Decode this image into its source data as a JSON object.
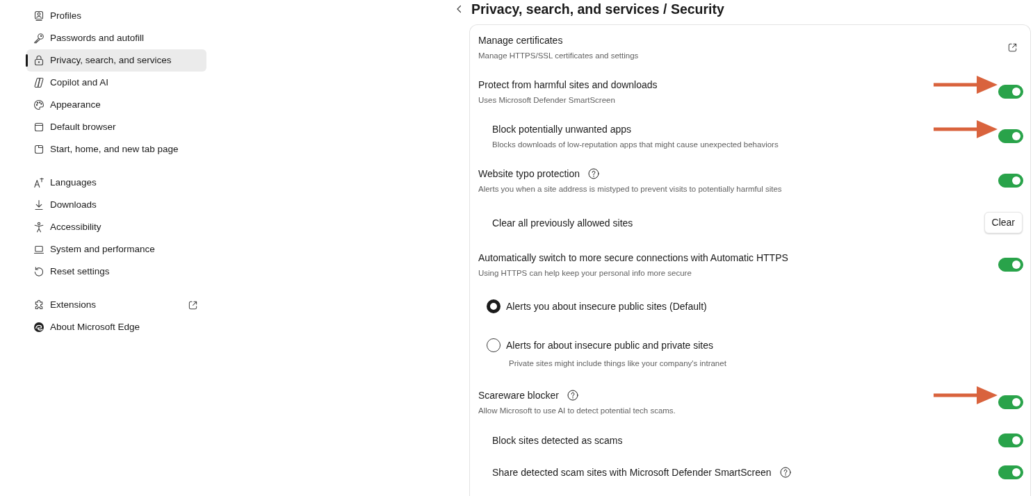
{
  "sidebar": {
    "groups": [
      {
        "items": [
          {
            "label": "Profiles",
            "selected": false,
            "external": false
          },
          {
            "label": "Passwords and autofill",
            "selected": false,
            "external": false
          },
          {
            "label": "Privacy, search, and services",
            "selected": true,
            "external": false
          },
          {
            "label": "Copilot and AI",
            "selected": false,
            "external": false
          },
          {
            "label": "Appearance",
            "selected": false,
            "external": false
          },
          {
            "label": "Default browser",
            "selected": false,
            "external": false
          },
          {
            "label": "Start, home, and new tab page",
            "selected": false,
            "external": false
          }
        ]
      },
      {
        "items": [
          {
            "label": "Languages",
            "selected": false,
            "external": false
          },
          {
            "label": "Downloads",
            "selected": false,
            "external": false
          },
          {
            "label": "Accessibility",
            "selected": false,
            "external": false
          },
          {
            "label": "System and performance",
            "selected": false,
            "external": false
          },
          {
            "label": "Reset settings",
            "selected": false,
            "external": false
          }
        ]
      },
      {
        "items": [
          {
            "label": "Extensions",
            "selected": false,
            "external": true
          },
          {
            "label": "About Microsoft Edge",
            "selected": false,
            "external": false
          }
        ]
      }
    ]
  },
  "header": {
    "title": "Privacy, search, and services / Security"
  },
  "settings": [
    {
      "kind": "link",
      "title": "Manage certificates",
      "description": "Manage HTTPS/SSL certificates and settings",
      "help": false,
      "highlighted": false
    },
    {
      "kind": "toggle",
      "title": "Protect from harmful sites and downloads",
      "description": "Uses Microsoft Defender SmartScreen",
      "help": false,
      "on": true,
      "highlighted": true,
      "children": [
        {
          "kind": "toggle",
          "title": "Block potentially unwanted apps",
          "description": "Blocks downloads of low-reputation apps that might cause unexpected behaviors",
          "help": false,
          "on": true,
          "highlighted": true
        }
      ]
    },
    {
      "kind": "toggle",
      "title": "Website typo protection",
      "description": "Alerts you when a site address is mistyped to prevent visits to potentially harmful sites",
      "help": true,
      "on": true,
      "highlighted": false,
      "children": [
        {
          "kind": "button",
          "title": "Clear all previously allowed sites",
          "button": "Clear",
          "help": false,
          "highlighted": false
        }
      ]
    },
    {
      "kind": "toggle",
      "title": "Automatically switch to more secure connections with Automatic HTTPS",
      "description": "Using HTTPS can help keep your personal info more secure",
      "help": false,
      "on": true,
      "highlighted": false,
      "children": [
        {
          "kind": "radio",
          "title": "Alerts you about insecure public sites (Default)",
          "help": false,
          "selected": true,
          "highlighted": false
        },
        {
          "kind": "radio",
          "title": "Alerts for about insecure public and private sites",
          "description": "Private sites might include things like your company's intranet",
          "help": false,
          "selected": false,
          "highlighted": false
        }
      ]
    },
    {
      "kind": "toggle",
      "title": "Scareware blocker",
      "description": "Allow Microsoft to use AI to detect potential tech scams.",
      "help": true,
      "on": true,
      "highlighted": true,
      "children": [
        {
          "kind": "toggle",
          "title": "Block sites detected as scams",
          "help": false,
          "on": true,
          "highlighted": false
        },
        {
          "kind": "toggle",
          "title": "Share detected scam sites with Microsoft Defender SmartScreen",
          "help": true,
          "on": true,
          "highlighted": false
        }
      ]
    }
  ]
}
